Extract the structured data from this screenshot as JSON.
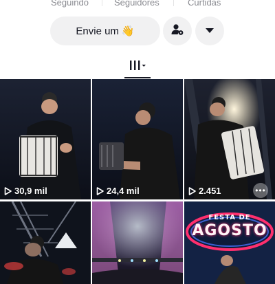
{
  "profile": {
    "stats": {
      "following_label": "Seguindo",
      "followers_label": "Seguidores",
      "likes_label": "Curtidas"
    },
    "actions": {
      "message_label": "Envie um",
      "message_emoji": "👋",
      "add_friend_icon": "person-gear-icon",
      "more_icon": "caret-down-icon"
    },
    "tabs": {
      "active_icon": "grid-videos-icon"
    }
  },
  "videos": [
    {
      "views": "30,9 mil"
    },
    {
      "views": "24,4 mil"
    },
    {
      "views": "2.451"
    },
    {
      "views": ""
    },
    {
      "views": ""
    },
    {
      "views": ""
    }
  ],
  "banner": {
    "top_text": "FESTA DE",
    "main_text": "AGOSTO"
  },
  "colors": {
    "text": "#161823",
    "secondary_text": "#8a8b91",
    "button_bg": "#f1f1f2"
  }
}
